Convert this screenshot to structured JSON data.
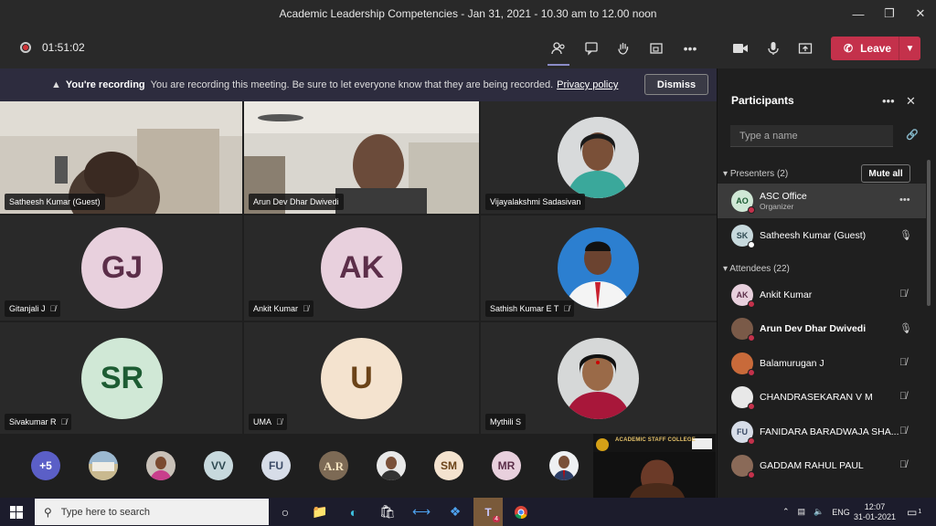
{
  "window": {
    "title": "Academic Leadership Competencies - Jan 31, 2021 - 10.30 am to 12.00 noon"
  },
  "toolbar": {
    "timer": "01:51:02",
    "leave_label": "Leave"
  },
  "banner": {
    "title": "You're recording",
    "message": "You are recording this meeting. Be sure to let everyone know that they are being recorded.",
    "link": "Privacy policy",
    "dismiss": "Dismiss"
  },
  "tiles": [
    {
      "name": "Satheesh Kumar (Guest)"
    },
    {
      "name": "Arun Dev Dhar Dwivedi"
    },
    {
      "name": "Vijayalakshmi Sadasivan"
    },
    {
      "name": "Gitanjali J",
      "initials": "GJ"
    },
    {
      "name": "Ankit Kumar",
      "initials": "AK"
    },
    {
      "name": "Sathish Kumar E T"
    },
    {
      "name": "Sivakumar R",
      "initials": "SR"
    },
    {
      "name": "UMA",
      "initials": "U"
    },
    {
      "name": "Mythili S"
    }
  ],
  "strip": {
    "overflow": "+5",
    "avatars": [
      "VV",
      "FU",
      "SM",
      "MR"
    ],
    "shared_text": "ACADEMIC STAFF COLLEGE"
  },
  "panel": {
    "title": "Participants",
    "search_placeholder": "Type a name",
    "presenters_label": "Presenters (2)",
    "mute_all": "Mute all",
    "attendees_label": "Attendees (22)",
    "presenters": [
      {
        "initials": "AO",
        "name": "ASC Office",
        "sub": "Organizer"
      },
      {
        "initials": "SK",
        "name": "Satheesh Kumar (Guest)"
      }
    ],
    "attendees": [
      {
        "initials": "AK",
        "name": "Ankit Kumar"
      },
      {
        "initials": "",
        "name": "Arun Dev Dhar Dwivedi"
      },
      {
        "initials": "",
        "name": "Balamurugan J"
      },
      {
        "initials": "",
        "name": "CHANDRASEKARAN V M"
      },
      {
        "initials": "FU",
        "name": "FANIDARA BARADWAJA SHA..."
      },
      {
        "initials": "",
        "name": "GADDAM RAHUL PAUL"
      }
    ]
  },
  "taskbar": {
    "search_placeholder": "Type here to search",
    "teams_badge": "4",
    "lang": "ENG",
    "time": "12:07",
    "date": "31-01-2021",
    "notif_count": "1"
  },
  "colors": {
    "leave": "#c4314b",
    "accent": "#8b8cc7",
    "banner": "#2d2c3e",
    "status_red": "#c4314b"
  }
}
